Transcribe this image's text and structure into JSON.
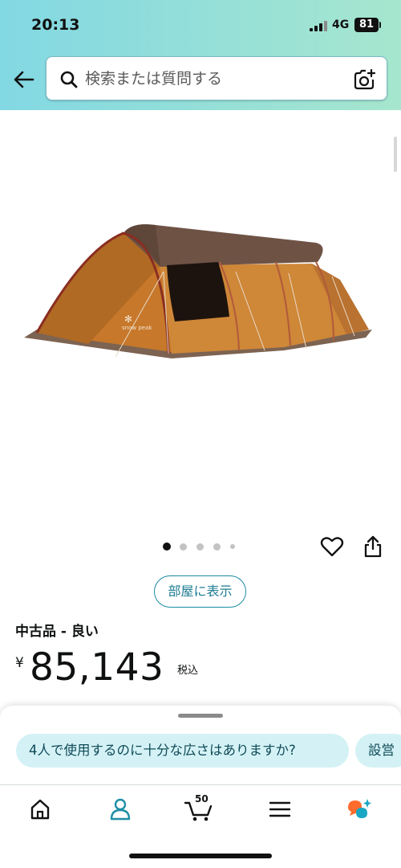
{
  "status_bar": {
    "time": "20:13",
    "network": "4G",
    "battery": "81"
  },
  "search": {
    "placeholder": "検索または質問する"
  },
  "product": {
    "image_count": 5,
    "active_image": 1,
    "view_in_room": "部屋に表示",
    "condition": "中古品 - 良い",
    "currency": "¥",
    "price": "85,143",
    "tax_note": "税込"
  },
  "tent_logo": "snow peak",
  "suggestions": [
    "4人で使用するのに十分な広さはありますか?",
    "設営"
  ],
  "nav": {
    "cart_count": "50"
  },
  "colors": {
    "header_start": "#82d8e3",
    "header_end": "#a6e6ce",
    "accent": "#1a8ba2",
    "chip": "#d4f2f6",
    "alexa_orange": "#ff6b2c",
    "alexa_teal": "#1aa7c4"
  },
  "icons": [
    "back-arrow-icon",
    "search-icon",
    "camera-icon",
    "heart-icon",
    "share-icon",
    "home-icon",
    "account-icon",
    "cart-icon",
    "menu-icon",
    "rufus-ai-icon"
  ]
}
